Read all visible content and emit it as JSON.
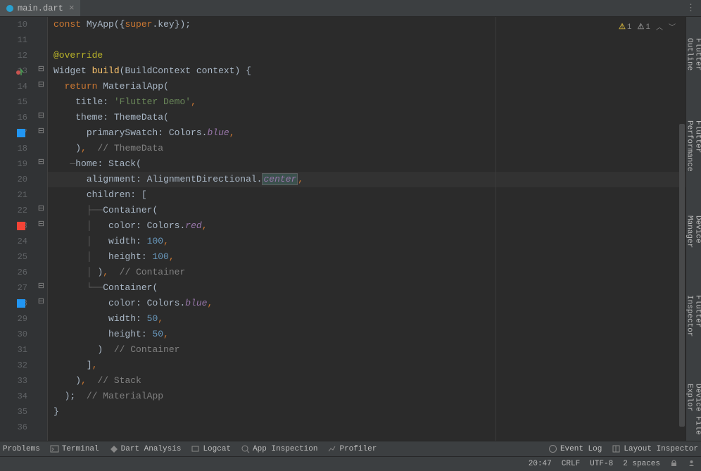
{
  "tab": {
    "filename": "main.dart"
  },
  "warnings": {
    "w1_count": "1",
    "w2_count": "1"
  },
  "gutter_lines": [
    "10",
    "11",
    "12",
    "13",
    "14",
    "15",
    "16",
    "17",
    "18",
    "19",
    "20",
    "21",
    "22",
    "23",
    "24",
    "25",
    "26",
    "27",
    "28",
    "29",
    "30",
    "31",
    "32",
    "33",
    "34",
    "35",
    "36"
  ],
  "code": {
    "l10_const": "const",
    "l10_myapp": "MyApp",
    "l10_super": "super",
    "l10_key": "key",
    "l12_override": "@override",
    "l13_widget": "Widget",
    "l13_build": "build",
    "l13_ctx": "BuildContext context",
    "l14_return": "return",
    "l14_matapp": "MaterialApp",
    "l15_title": "title",
    "l15_str": "'Flutter Demo'",
    "l16_theme": "theme",
    "l16_td": "ThemeData",
    "l17_ps": "primarySwatch",
    "l17_colors": "Colors",
    "l17_blue": "blue",
    "l18_cmt": "// ThemeData",
    "l19_home": "home",
    "l19_stack": "Stack",
    "l20_align": "alignment",
    "l20_ad": "AlignmentDirectional",
    "l20_center": "center",
    "l21_children": "children",
    "l22_container": "Container",
    "l23_color": "color",
    "l23_colors": "Colors",
    "l23_red": "red",
    "l24_width": "width",
    "l24_val": "100",
    "l25_height": "height",
    "l25_val": "100",
    "l26_cmt": "// Container",
    "l27_container": "Container",
    "l28_color": "color",
    "l28_colors": "Colors",
    "l28_blue": "blue",
    "l29_width": "width",
    "l29_val": "50",
    "l30_height": "height",
    "l30_val": "50",
    "l31_cmt": "// Container",
    "l33_cmt": "// Stack",
    "l34_cmt": "// MaterialApp"
  },
  "right_panels": [
    "Flutter Outline",
    "Flutter Performance",
    "Device Manager",
    "Flutter Inspector",
    "Device File Explor"
  ],
  "bottom_tabs": {
    "problems": "Problems",
    "terminal": "Terminal",
    "dart": "Dart Analysis",
    "logcat": "Logcat",
    "appinsp": "App Inspection",
    "profiler": "Profiler",
    "eventlog": "Event Log",
    "layout": "Layout Inspector"
  },
  "status": {
    "pos": "20:47",
    "eol": "CRLF",
    "encoding": "UTF-8",
    "indent": "2 spaces"
  }
}
